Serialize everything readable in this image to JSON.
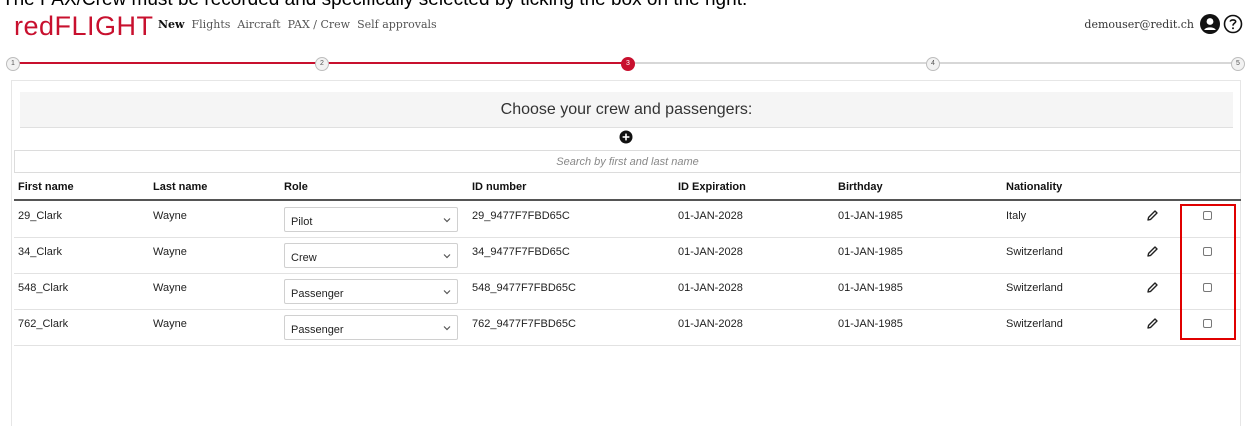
{
  "caption": "The PAX/Crew must be recorded and specifically selected by ticking the box on the right:",
  "app": {
    "logo_part1": "red",
    "logo_part2": "FLIGHT"
  },
  "nav": [
    {
      "label": "New",
      "active": true
    },
    {
      "label": "Flights",
      "active": false
    },
    {
      "label": "Aircraft",
      "active": false
    },
    {
      "label": "PAX / Crew",
      "active": false
    },
    {
      "label": "Self approvals",
      "active": false
    }
  ],
  "user": {
    "email": "demouser@redit.ch",
    "icons": [
      "user-icon",
      "help-icon"
    ]
  },
  "stepper": {
    "steps": [
      "1",
      "2",
      "3",
      "4",
      "5"
    ],
    "current_step": 3,
    "accent": "#c8102e"
  },
  "section": {
    "title": "Choose your crew and passengers:",
    "add_icon": "plus-circle-icon"
  },
  "search": {
    "placeholder": "Search by first and last name",
    "value": ""
  },
  "table": {
    "columns": [
      "First name",
      "Last name",
      "Role",
      "ID number",
      "ID Expiration",
      "Birthday",
      "Nationality"
    ],
    "rows": [
      {
        "first": "29_Clark",
        "last": "Wayne",
        "role": "Pilot",
        "id": "29_9477F7FBD65C",
        "exp": "01-JAN-2028",
        "birthday": "01-JAN-1985",
        "nationality": "Italy"
      },
      {
        "first": "34_Clark",
        "last": "Wayne",
        "role": "Crew",
        "id": "34_9477F7FBD65C",
        "exp": "01-JAN-2028",
        "birthday": "01-JAN-1985",
        "nationality": "Switzerland"
      },
      {
        "first": "548_Clark",
        "last": "Wayne",
        "role": "Passenger",
        "id": "548_9477F7FBD65C",
        "exp": "01-JAN-2028",
        "birthday": "01-JAN-1985",
        "nationality": "Switzerland"
      },
      {
        "first": "762_Clark",
        "last": "Wayne",
        "role": "Passenger",
        "id": "762_9477F7FBD65C",
        "exp": "01-JAN-2028",
        "birthday": "01-JAN-1985",
        "nationality": "Switzerland"
      }
    ]
  },
  "colors": {
    "brand": "#c8102e",
    "highlight": "#e00000"
  }
}
